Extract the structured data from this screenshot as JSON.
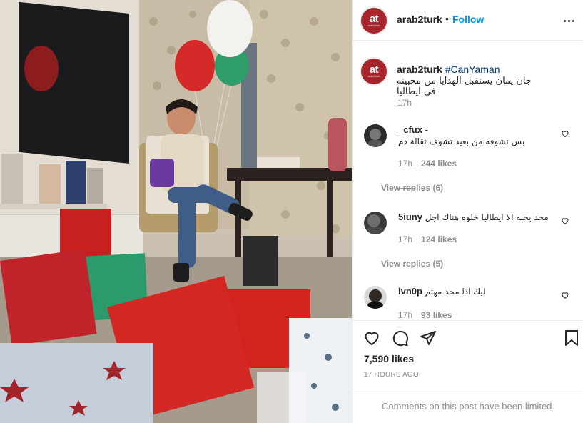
{
  "post": {
    "username": "arab2turk",
    "follow_label": "Follow",
    "dot": "•",
    "logo_text": "at",
    "logo_subtext": "arab2turk"
  },
  "caption": {
    "username": "arab2turk",
    "hashtag": "#CanYaman",
    "text": "جان يمان يستقبل الهدايا من محبينه في ايطاليا",
    "time": "17h"
  },
  "comments": [
    {
      "username": "_cfux -",
      "text": "بس تشوفه من بعيد تشوف ثقالة دم",
      "time": "17h",
      "likes": "244 likes",
      "view_replies": "View replies (6)"
    },
    {
      "username": "5iuny",
      "text": "محد يحبه الا ايطاليا خلوه هناك اجل",
      "time": "17h",
      "likes": "124 likes",
      "view_replies": "View replies (5)"
    },
    {
      "username": "lvn0p",
      "text": "ليك اذا محد مهتم",
      "time": "17h",
      "likes": "93 likes"
    }
  ],
  "actions": {
    "likes": "7,590 likes",
    "time_ago": "17 HOURS AGO"
  },
  "footer": {
    "limited_text": "Comments on this post have been limited."
  },
  "icons": {
    "like": "heart-icon",
    "comment": "comment-icon",
    "share": "paper-plane-icon",
    "save": "bookmark-icon",
    "more": "more-options-icon"
  },
  "colors": {
    "link": "#0095f6",
    "hashtag": "#00376b",
    "muted": "#8e8e8e",
    "brand": "#a9252c"
  }
}
